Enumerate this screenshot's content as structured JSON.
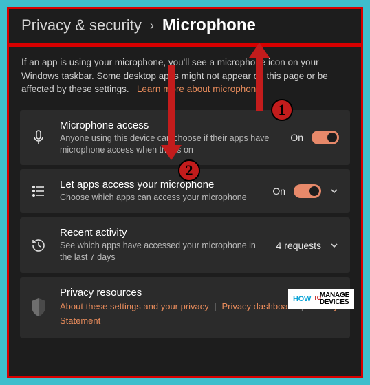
{
  "breadcrumb": {
    "parent": "Privacy & security",
    "current": "Microphone"
  },
  "intro": {
    "text": "If an app is using your microphone, you'll see a microphone icon on your Windows taskbar. Some desktop apps might not appear on this page or be affected by these settings.",
    "link": "Learn more about microphone"
  },
  "rows": {
    "access": {
      "title": "Microphone access",
      "sub": "Anyone using this device can choose if their apps have microphone access when this is on",
      "state": "On"
    },
    "apps": {
      "title": "Let apps access your microphone",
      "sub": "Choose which apps can access your microphone",
      "state": "On"
    },
    "recent": {
      "title": "Recent activity",
      "sub": "See which apps have accessed your microphone in the last 7 days",
      "requests": "4 requests"
    },
    "privacy": {
      "title": "Privacy resources",
      "link1": "About these settings and your privacy",
      "link2": "Privacy dashboard",
      "link3": "Privacy Statement"
    }
  },
  "annotations": {
    "badge1": "1",
    "badge2": "2"
  },
  "watermark": {
    "how": "HOW",
    "to": "TO",
    "line1": "MANAGE",
    "line2": "DEVICES"
  }
}
